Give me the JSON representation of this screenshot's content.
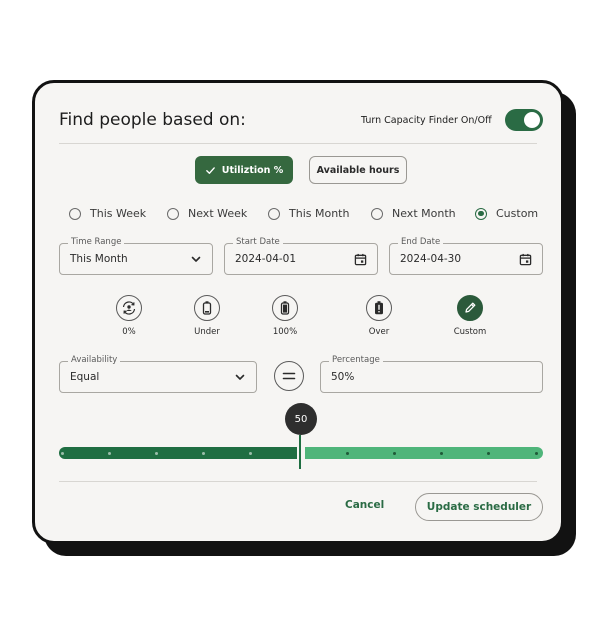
{
  "header": {
    "title": "Find people based on:",
    "toggle_label": "Turn Capacity Finder On/Off",
    "toggle_on": true
  },
  "mode_tabs": [
    {
      "label": "Utiliztion %",
      "selected": true
    },
    {
      "label": "Available hours",
      "selected": false
    }
  ],
  "period_options": [
    {
      "label": "This Week",
      "checked": false
    },
    {
      "label": "Next Week",
      "checked": false
    },
    {
      "label": "This Month",
      "checked": false
    },
    {
      "label": "Next Month",
      "checked": false
    },
    {
      "label": "Custom",
      "checked": true
    }
  ],
  "filters": {
    "time_range": {
      "label": "Time Range",
      "value": "This Month"
    },
    "start_date": {
      "label": "Start Date",
      "value": "2024-04-01"
    },
    "end_date": {
      "label": "End Date",
      "value": "2024-04-30"
    }
  },
  "capacity_options": [
    {
      "label": "0%",
      "icon": "sync-person-icon"
    },
    {
      "label": "Under",
      "icon": "battery-low-icon"
    },
    {
      "label": "100%",
      "icon": "battery-full-icon"
    },
    {
      "label": "Over",
      "icon": "battery-alert-icon"
    },
    {
      "label": "Custom",
      "icon": "pencil-icon",
      "selected": true
    }
  ],
  "availability": {
    "label": "Availability",
    "value": "Equal",
    "operator_icon": "equals-icon",
    "percentage_label": "Percentage",
    "percentage_value": "50%"
  },
  "slider": {
    "value": "50",
    "min": 0,
    "max": 100
  },
  "actions": {
    "cancel": "Cancel",
    "update": "Update scheduler"
  },
  "colors": {
    "primary": "#2a6b44",
    "track_filled": "#1f6e42",
    "track_rest": "#4fb57a",
    "card_bg": "#f6f5f3"
  }
}
